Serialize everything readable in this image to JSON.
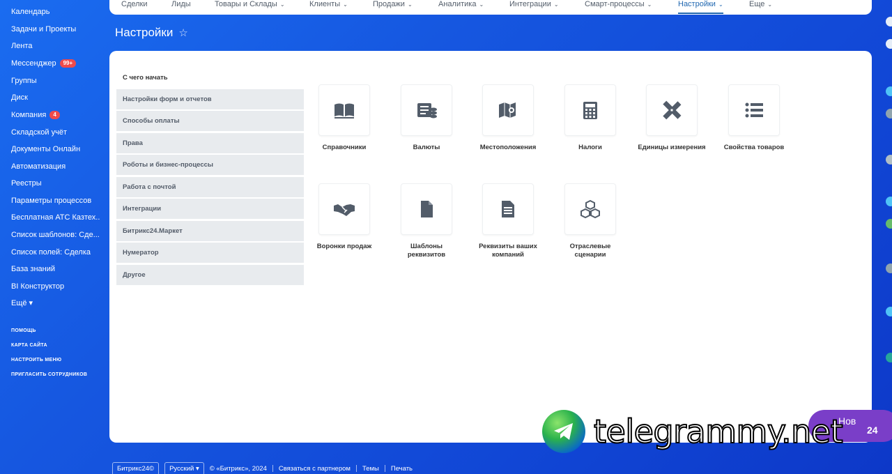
{
  "sidebar": {
    "items": [
      {
        "label": "Календарь"
      },
      {
        "label": "Задачи и Проекты"
      },
      {
        "label": "Лента"
      },
      {
        "label": "Мессенджер",
        "badge": "99+"
      },
      {
        "label": "Группы"
      },
      {
        "label": "Диск"
      },
      {
        "label": "Компания",
        "badge": "4"
      },
      {
        "label": "Складской учёт"
      },
      {
        "label": "Документы Онлайн"
      },
      {
        "label": "Автоматизация"
      },
      {
        "label": "Реестры"
      },
      {
        "label": "Параметры процессов"
      },
      {
        "label": "Бесплатная АТС Казтех..."
      },
      {
        "label": "Список шаблонов: Сде..."
      },
      {
        "label": "Список полей: Сделка"
      },
      {
        "label": "База знаний"
      },
      {
        "label": "BI Конструктор"
      },
      {
        "label": "Ещё ▾"
      }
    ],
    "links": [
      "ПОМОЩЬ",
      "КАРТА САЙТА",
      "НАСТРОИТЬ МЕНЮ",
      "ПРИГЛАСИТЬ СОТРУДНИКОВ"
    ]
  },
  "topnav": {
    "items": [
      {
        "label": "Сделки"
      },
      {
        "label": "Лиды"
      },
      {
        "label": "Товары и Склады",
        "dropdown": "⌄"
      },
      {
        "label": "Клиенты",
        "dropdown": "⌄"
      },
      {
        "label": "Продажи",
        "dropdown": "⌄"
      },
      {
        "label": "Аналитика",
        "dropdown": "⌄"
      },
      {
        "label": "Интеграции",
        "dropdown": "⌄"
      },
      {
        "label": "Смарт-процессы",
        "dropdown": "⌄"
      },
      {
        "label": "Настройки",
        "dropdown": "⌄",
        "active": true
      },
      {
        "label": "Еще",
        "dropdown": "⌄"
      }
    ]
  },
  "page": {
    "title": "Настройки",
    "star": "☆"
  },
  "settings_menu": {
    "header": "С чего начать",
    "items": [
      "Настройки форм и отчетов",
      "Способы оплаты",
      "Права",
      "Роботы и бизнес-процессы",
      "Работа с почтой",
      "Интеграции",
      "Битрикс24.Маркет",
      "Нумератор",
      "Другое"
    ]
  },
  "tiles": [
    {
      "label": "Справочники",
      "icon": "book-icon"
    },
    {
      "label": "Валюты",
      "icon": "currency-icon"
    },
    {
      "label": "Местоположения",
      "icon": "map-icon"
    },
    {
      "label": "Налоги",
      "icon": "calculator-icon"
    },
    {
      "label": "Единицы измерения",
      "icon": "ruler-pencil-icon"
    },
    {
      "label": "Свойства товаров",
      "icon": "list-icon"
    },
    {
      "label": "Воронки продаж",
      "icon": "handshake-icon"
    },
    {
      "label": "Шаблоны реквизитов",
      "icon": "file-icon"
    },
    {
      "label": "Реквизиты ваших компаний",
      "icon": "document-icon"
    },
    {
      "label": "Отраслевые сценарии",
      "icon": "cubes-icon"
    }
  ],
  "footer": {
    "brand": "Битрикс24©",
    "language": "Русский ▾",
    "copyright": "© «Битрикс», 2024",
    "contact": "Связаться с партнером",
    "themes": "Темы",
    "print": "Печать"
  },
  "watermark": {
    "text": "telegrammy.net"
  },
  "overlay": {
    "pill_text": "Нов",
    "pill_sub": "24"
  },
  "colors": {
    "accent": "#2067b0",
    "menu_bg": "#e8ebee",
    "icon": "#525c69",
    "badge": "#ef4b4b"
  }
}
